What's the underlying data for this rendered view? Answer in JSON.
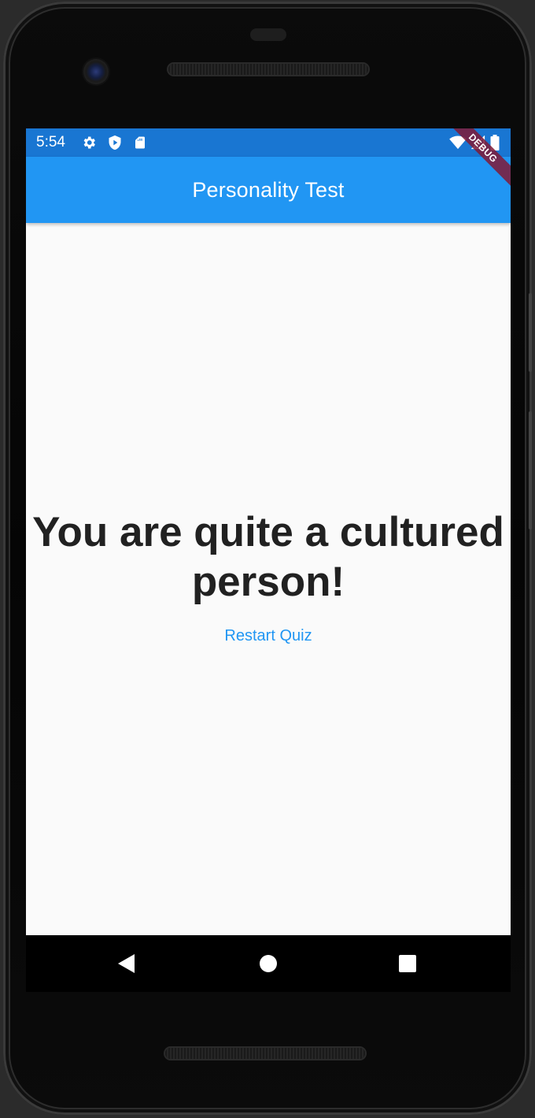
{
  "status_bar": {
    "time": "5:54",
    "left_icons": [
      "settings-icon",
      "shield-icon",
      "sd-card-icon"
    ],
    "right_icons": [
      "wifi-icon",
      "signal-icon",
      "battery-icon"
    ],
    "color": "#1976d2"
  },
  "app_bar": {
    "title": "Personality Test",
    "color": "#2196f3"
  },
  "debug_banner": {
    "label": "DEBUG"
  },
  "main": {
    "result_text": "You are quite a cultured person!",
    "restart_label": "Restart Quiz",
    "accent": "#2196f3",
    "text_color": "#212121"
  },
  "nav_bar": {
    "buttons": [
      "back-icon",
      "home-icon",
      "recents-icon"
    ]
  }
}
